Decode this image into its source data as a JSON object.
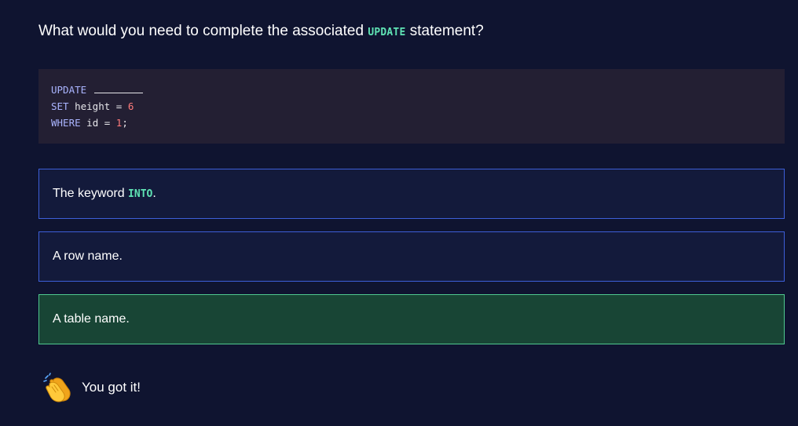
{
  "question": {
    "before": "What would you need to complete the associated ",
    "keyword": "UPDATE",
    "after": " statement?"
  },
  "code": {
    "line1": {
      "kw": "UPDATE"
    },
    "line2": {
      "kw": "SET",
      "ident": " height = ",
      "num": "6"
    },
    "line3": {
      "kw": "WHERE",
      "ident": " id = ",
      "num": "1",
      "end": ";"
    }
  },
  "options": [
    {
      "before": "The keyword ",
      "keyword": "INTO",
      "after": ".",
      "state": "incorrect"
    },
    {
      "text": "A row name.",
      "state": "incorrect"
    },
    {
      "text": "A table name.",
      "state": "correct"
    }
  ],
  "feedback": {
    "icon": "clapping-hands-icon",
    "text": "You got it!"
  },
  "colors": {
    "background": "#0f1430",
    "keyword": "#5fe3b4",
    "option_border": "#3d5fd8",
    "correct_border": "#4fc98f",
    "correct_bg": "#184535",
    "code_bg": "#231f33"
  }
}
